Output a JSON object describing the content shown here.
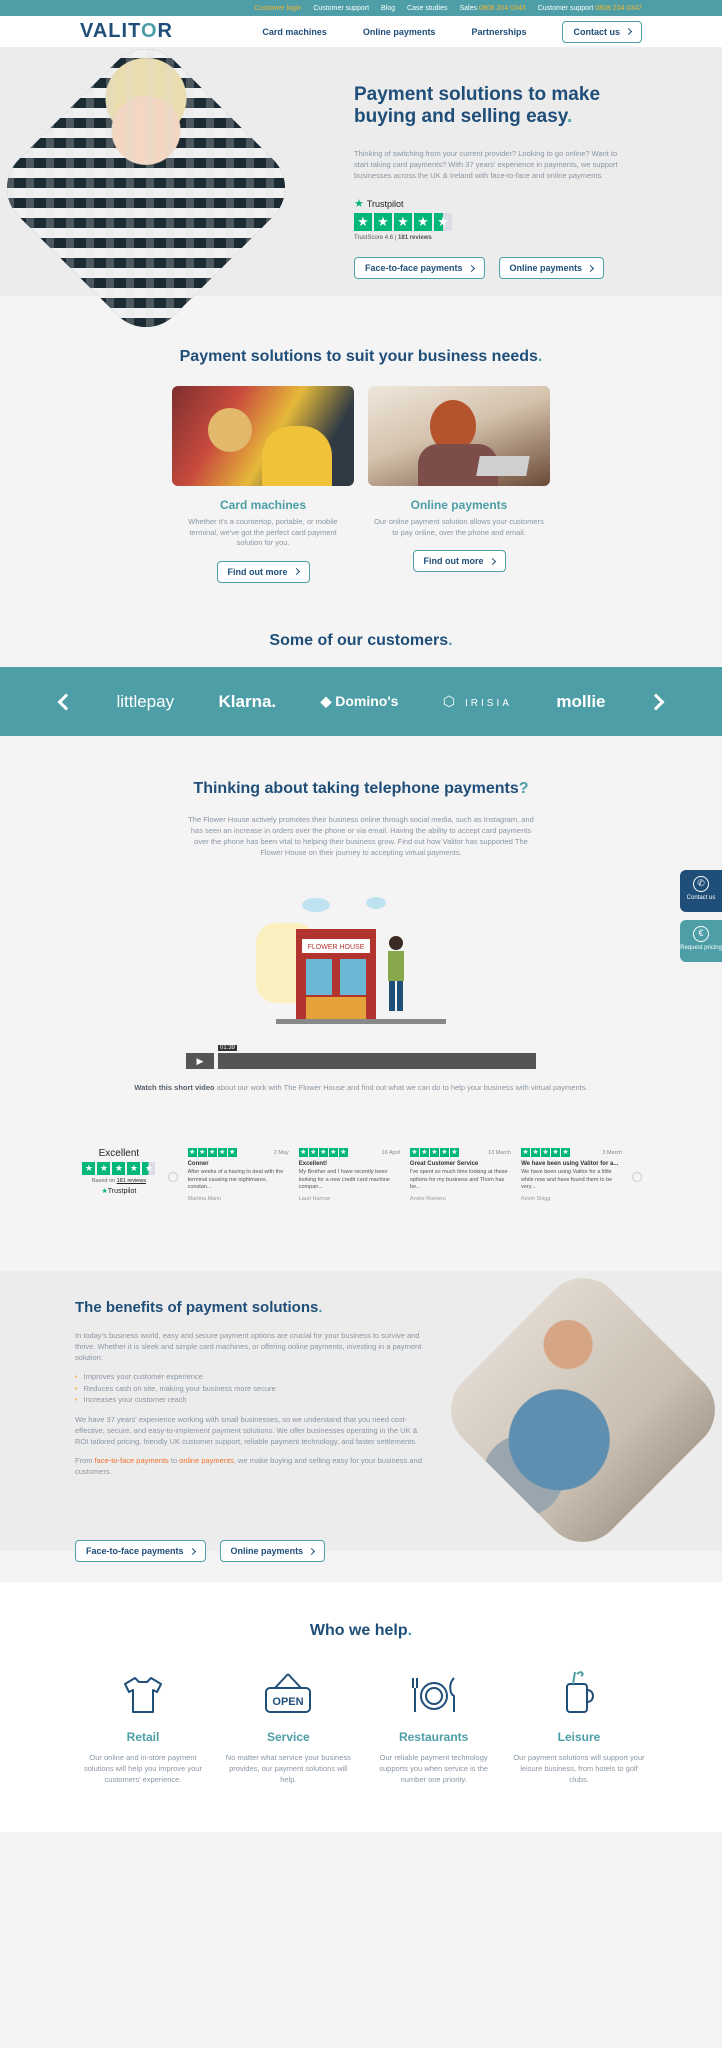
{
  "topbar": {
    "login": "Customer login",
    "support": "Customer support",
    "blog": "Blog",
    "case_studies": "Case studies",
    "sales_label": "Sales",
    "sales_phone": "0808 204 0343",
    "support_label": "Customer support",
    "support_phone": "0808 204 0347"
  },
  "header": {
    "logo_main": "VALIT",
    "logo_accent": "O",
    "logo_end": "R",
    "nav": [
      "Card machines",
      "Online payments",
      "Partnerships"
    ],
    "contact": "Contact us"
  },
  "hero": {
    "title": "Payment solutions to make buying and selling easy",
    "title_dot": ".",
    "subtitle": "Thinking of switching from your current provider? Looking to go online? Want to start taking card payments? With 37 years' experience in payments, we support businesses across the UK & Ireland with face-to-face and online payments.",
    "trustpilot_brand": "Trustpilot",
    "trustscore": "TrustScore 4.6",
    "reviews": "181 reviews",
    "btn_face": "Face-to-face payments",
    "btn_online": "Online payments"
  },
  "solutions": {
    "title": "Payment solutions to suit your business needs",
    "dot": ".",
    "cards": [
      {
        "title": "Card machines",
        "text": "Whether it's a countertop, portable, or mobile terminal, we've got the perfect card payment solution for you.",
        "btn": "Find out more"
      },
      {
        "title": "Online payments",
        "text": "Our online payment solution allows your customers to pay online, over the phone and email.",
        "btn": "Find out more"
      }
    ]
  },
  "customers": {
    "title": "Some of our customers",
    "dot": ".",
    "logos": [
      "littlepay",
      "Klarna.",
      "Domino's",
      "IRISIA",
      "mollie"
    ]
  },
  "telephone": {
    "title": "Thinking about taking telephone payments",
    "mark": "?",
    "text": "The Flower House actively promotes their business online through social media, such as Instagram, and has seen an increase in orders over the phone or via email. Having the ability to accept card payments over the phone has been vital to helping their business grow. Find out how Valitor has supported The Flower House on their journey to accepting virtual payments.",
    "video_time": "01:39",
    "shop_sign": "FLOWER HOUSE",
    "caption_bold": "Watch this short video",
    "caption": " about our work with The Flower House and find out what we can do to help your business with virtual payments."
  },
  "reviews": {
    "summary": "Excellent",
    "based_on": "Based on",
    "based_count": "181 reviews",
    "brand": "Trustpilot",
    "items": [
      {
        "date": "2 May",
        "title": "Conner",
        "body": "After weeks of a having to deal with the terminal causing me nightmares, constan...",
        "author": "Martina Mann"
      },
      {
        "date": "16 April",
        "title": "Excellent!",
        "body": "My Brother and I have recently been looking for a new credit card machine compan...",
        "author": "Lauri Harrow"
      },
      {
        "date": "13 March",
        "title": "Great Customer Service",
        "body": "I've spent so much time looking at these options for my business and Thom has be...",
        "author": "Andre Romero"
      },
      {
        "date": "3 March",
        "title": "We have been using Valitor for a...",
        "body": "We have been using Valitor for a little while now and have found them to be very...",
        "author": "Kevin Shigg"
      }
    ]
  },
  "benefits": {
    "title": "The benefits of payment solutions",
    "dot": ".",
    "p1": "In today's business world, easy and secure payment options are crucial for your business to survive and thrive. Whether it is sleek and simple card machines, or offering online payments, investing in a payment solution:",
    "list": [
      "Improves your customer experience",
      "Reduces cash on site, making your business more secure",
      "Increases your customer reach"
    ],
    "p2": "We have 37 years' experience working with small businesses, so we understand that you need cost-effective, secure, and easy-to-implement payment solutions. We offer businesses operating in the UK & ROI tailored pricing, friendly UK customer support, reliable payment technology, and faster settlements.",
    "p3_from": "From ",
    "p3_link1": "face-to-face payments",
    "p3_to": " to ",
    "p3_link2": "online payments",
    "p3_end": ", we make buying and selling easy for your business and customers.",
    "btn_face": "Face-to-face payments",
    "btn_online": "Online payments"
  },
  "help": {
    "title": "Who we help",
    "dot": ".",
    "items": [
      {
        "title": "Retail",
        "text": "Our online and in-store payment solutions will help you improve your customers' experience."
      },
      {
        "title": "Service",
        "text": "No matter what service your business provides, our payment solutions will help."
      },
      {
        "title": "Restaurants",
        "text": "Our reliable payment technology supports you when service is the number one priority."
      },
      {
        "title": "Leisure",
        "text": "Our payment solutions will support your leisure business, from hotels to golf clubs."
      }
    ],
    "open_sign": "OPEN"
  },
  "side": {
    "contact": "Contact us",
    "pricing": "Request pricing"
  },
  "colors": {
    "navy": "#1f4e79",
    "teal": "#4d9ea6",
    "yellow": "#f5b335",
    "trustpilot": "#00b67a",
    "orange": "#f0702e"
  }
}
